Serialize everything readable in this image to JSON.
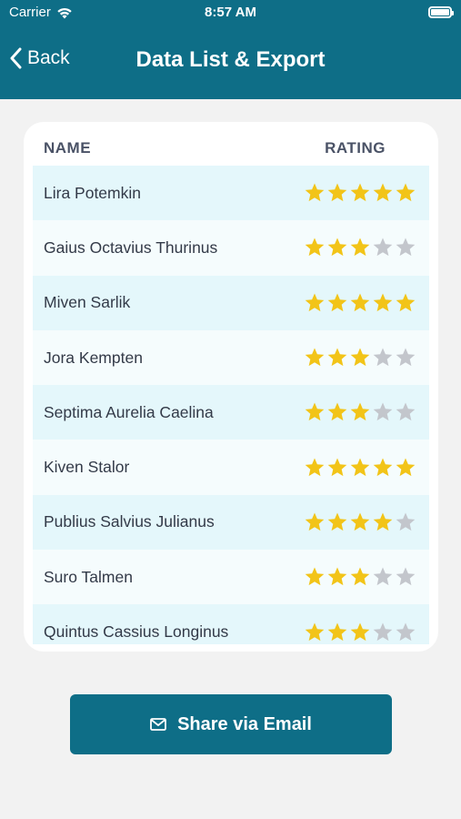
{
  "status_bar": {
    "carrier": "Carrier",
    "time": "8:57 AM"
  },
  "nav": {
    "back_label": "Back",
    "title": "Data List & Export"
  },
  "table": {
    "headers": {
      "name": "NAME",
      "rating": "RATING"
    },
    "max_rating": 5,
    "rows": [
      {
        "name": "Lira Potemkin",
        "rating": 5
      },
      {
        "name": "Gaius Octavius Thurinus",
        "rating": 3
      },
      {
        "name": "Miven Sarlik",
        "rating": 5
      },
      {
        "name": "Jora Kempten",
        "rating": 3
      },
      {
        "name": "Septima Aurelia Caelina",
        "rating": 3
      },
      {
        "name": "Kiven Stalor",
        "rating": 5
      },
      {
        "name": "Publius Salvius Julianus",
        "rating": 4
      },
      {
        "name": "Suro Talmen",
        "rating": 3
      },
      {
        "name": "Quintus Cassius Longinus",
        "rating": 3
      }
    ]
  },
  "share": {
    "label": "Share via Email",
    "icon": "envelope-icon"
  },
  "colors": {
    "header_bg": "#0e6e87",
    "star_filled": "#f2c418",
    "star_empty": "#c3c6cc",
    "row_odd": "#e4f7fb",
    "row_even": "#f5fcfd"
  }
}
